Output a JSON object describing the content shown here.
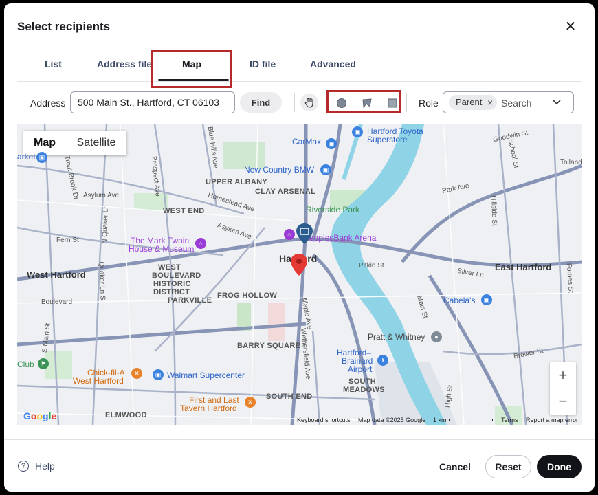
{
  "dialog": {
    "title": "Select recipients",
    "close_icon": "close-icon"
  },
  "tabs": [
    {
      "label": "List"
    },
    {
      "label": "Address file"
    },
    {
      "label": "Map",
      "active": true
    },
    {
      "label": "ID file"
    },
    {
      "label": "Advanced"
    }
  ],
  "toolbar": {
    "address_label": "Address",
    "address_value": "500 Main St., Hartford, CT 06103",
    "find_label": "Find",
    "tools": [
      "hand-pan-icon",
      "circle-draw-icon",
      "polygon-draw-icon",
      "rectangle-draw-icon"
    ],
    "role_label": "Role",
    "role_chip": "Parent",
    "role_placeholder": "Search"
  },
  "map": {
    "type_map": "Map",
    "type_satellite": "Satellite",
    "zoom_in": "+",
    "zoom_out": "−",
    "google": "Google",
    "keyboard_shortcuts": "Keyboard shortcuts",
    "map_data": "Map data ©2025 Google",
    "scale": "1 km",
    "terms": "Terms",
    "report": "Report a map error",
    "labels": {
      "hartford": "Hartford",
      "west_hartford": "West Hartford",
      "east_hartford": "East Hartford",
      "upper_albany": "UPPER ALBANY",
      "clay_arsenal": "CLAY ARSENAL",
      "west_end": "WEST END",
      "west_boulevard": "WEST",
      "west_boulevard2": "BOULEVARD",
      "west_boulevard3": "HISTORIC",
      "west_boulevard4": "DISTRICT",
      "parkville": "PARKVILLE",
      "frog_hollow": "FROG HOLLOW",
      "barry_square": "BARRY SQUARE",
      "south_end": "SOUTH END",
      "south_meadows": "SOUTH",
      "south_meadows2": "MEADOWS",
      "elmwood": "ELMWOOD",
      "riverside_park": "Riverside Park",
      "mark_twain": "The Mark Twain",
      "mark_twain2": "House & Museum",
      "peoples_bank": "PeoplesBank Arena",
      "carmax": "CarMax",
      "new_country_bmw": "New Country BMW",
      "hartford_toyota": "Hartford Toyota",
      "hartford_toyota2": "Superstore",
      "cabelas": "Cabela's",
      "pratt_whitney": "Pratt & Whitney",
      "brainard": "Hartford–",
      "brainard2": "Brainard",
      "brainard3": "Airport",
      "chick_fil_a": "Chick-fil-A",
      "chick_fil_a2": "West Hartford",
      "walmart": "Walmart Supercenter",
      "first_last": "First and Last",
      "first_last2": "Tavern Hartford",
      "club": "Club",
      "market": "arket",
      "asylum_ave": "Asylum Ave",
      "asylum_ave2": "Asylum Ave",
      "homestead_ave": "Homestead Ave",
      "fern_st": "Fern St",
      "boulevard": "Boulevard",
      "park_ave": "Park Ave",
      "silver_ln": "Silver Ln",
      "brewer_st": "Brewer St",
      "pitkin_st": "Pitkin St",
      "goodwin_st": "Goodwin St",
      "tolland": "Tolland",
      "main_st": "Main St",
      "maple_ave": "Maple Ave",
      "wethersfield_ave": "Wethersfield Ave",
      "prospect_ave": "Prospect Ave",
      "blue_hills_ave": "Blue Hills Ave",
      "trout_brook_dr": "Trout Brook Dr",
      "quaker_ln": "Quaker Ln S",
      "hillside_st": "Hillside St",
      "school_st": "School St",
      "forbes_st": "Forbes St",
      "high_st": "High St",
      "s_main_st": "S Main St",
      "n_quaker_ln": "N Quaker Ln"
    }
  },
  "footer": {
    "help": "Help",
    "cancel": "Cancel",
    "reset": "Reset",
    "done": "Done"
  },
  "colors": {
    "highlight": "#b52a2a",
    "primary": "#111318",
    "pin": "#e53935"
  }
}
